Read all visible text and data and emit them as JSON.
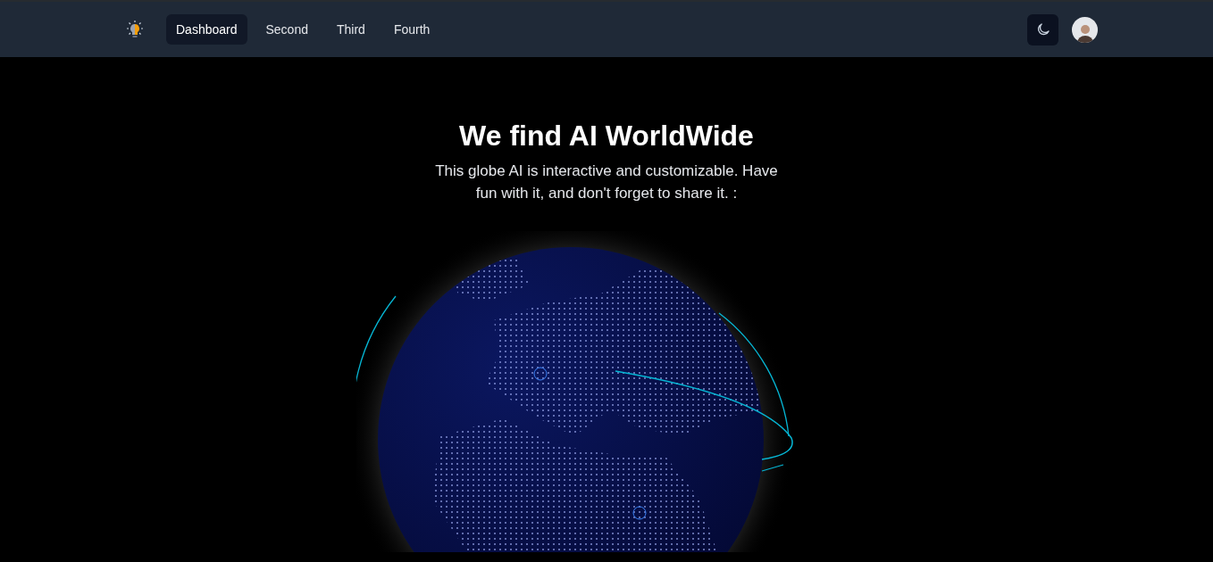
{
  "nav": {
    "items": [
      {
        "label": "Dashboard",
        "selected": true
      },
      {
        "label": "Second",
        "selected": false
      },
      {
        "label": "Third",
        "selected": false
      },
      {
        "label": "Fourth",
        "selected": false
      }
    ]
  },
  "hero": {
    "title": "We find AI WorldWide",
    "subtitle": "This globe AI is interactive and customizable. Have fun with it, and don't forget to share it. :"
  }
}
